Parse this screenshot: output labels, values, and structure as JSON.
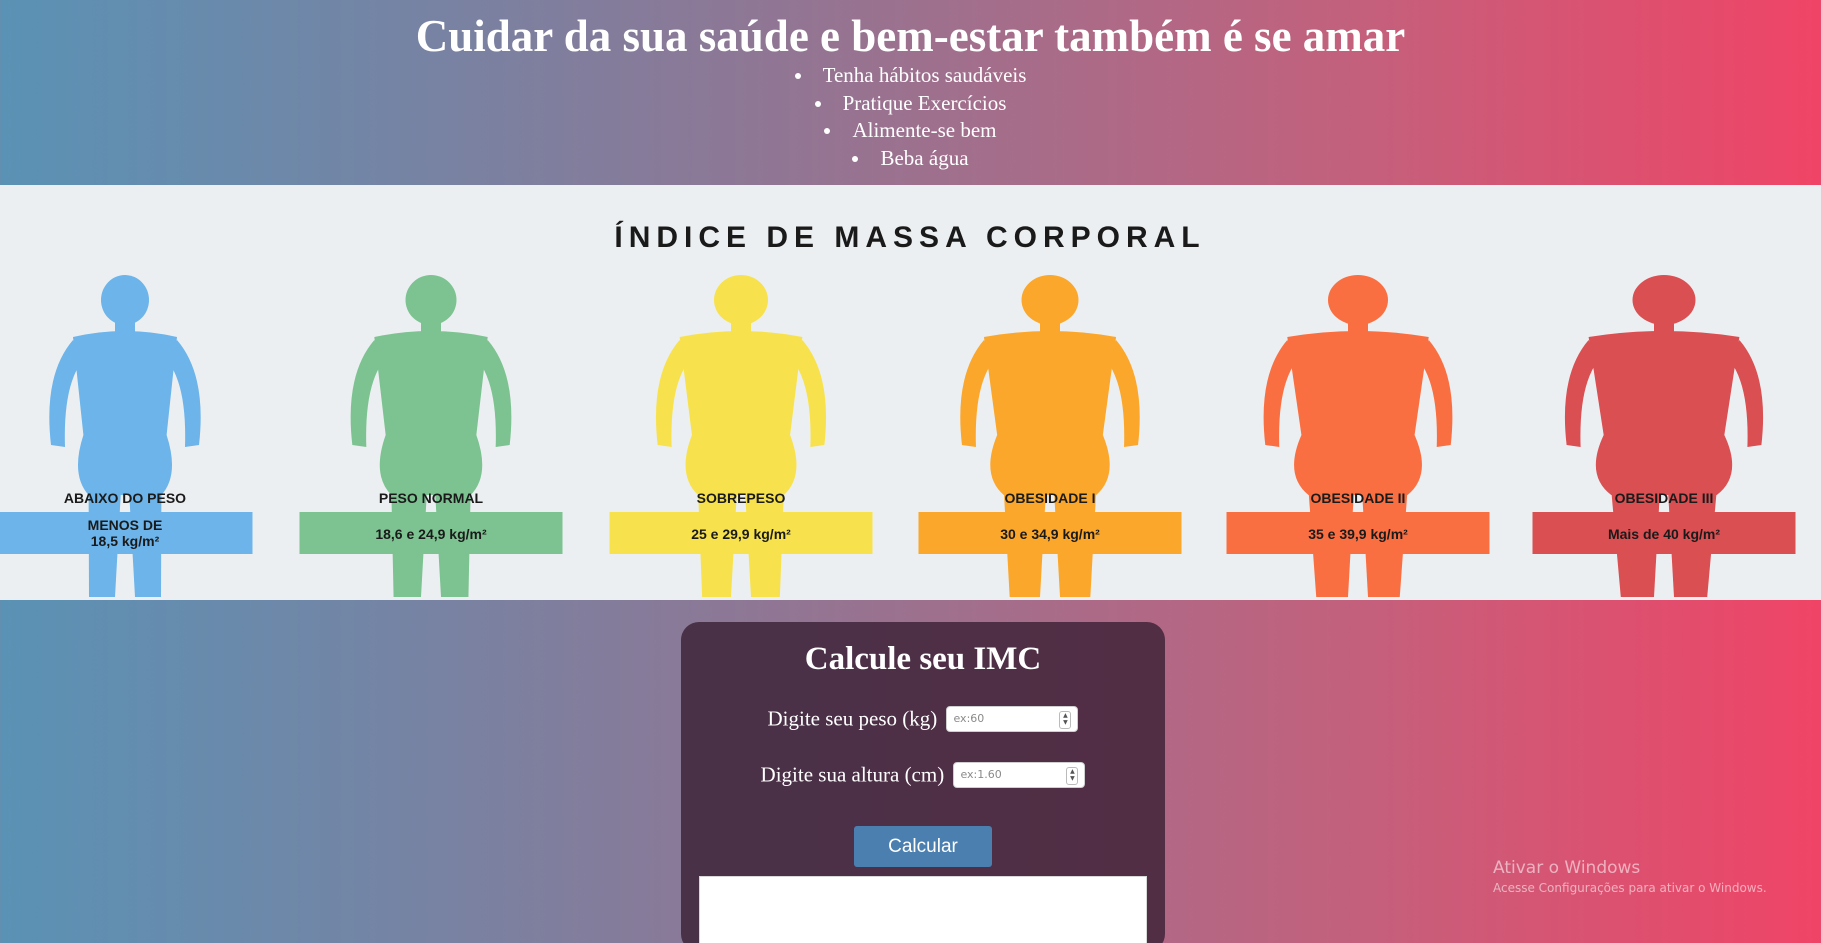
{
  "header": {
    "title": "Cuidar da sua saúde e bem-estar também é se amar",
    "tips": [
      "Tenha hábitos saudáveis",
      "Pratique Exercícios",
      "Alimente-se bem",
      "Beba água"
    ]
  },
  "bmi_chart": {
    "heading": "ÍNDICE DE MASSA CORPORAL",
    "categories": [
      {
        "name": "ABAIXO DO PESO",
        "range_line1": "MENOS DE",
        "range_line2": "18,5 kg/m²",
        "color": "#6cb4ea"
      },
      {
        "name": "PESO NORMAL",
        "range_line1": "18,6 e 24,9 kg/m²",
        "range_line2": "",
        "color": "#7dc391"
      },
      {
        "name": "SOBREPESO",
        "range_line1": "25 e 29,9 kg/m²",
        "range_line2": "",
        "color": "#f7e24e"
      },
      {
        "name": "OBESIDADE I",
        "range_line1": "30 e 34,9 kg/m²",
        "range_line2": "",
        "color": "#fba72c"
      },
      {
        "name": "OBESIDADE II",
        "range_line1": "35 e 39,9 kg/m²",
        "range_line2": "",
        "color": "#fa6f42"
      },
      {
        "name": "OBESIDADE III",
        "range_line1": "Mais de 40 kg/m²",
        "range_line2": "",
        "color": "#d94f52"
      }
    ]
  },
  "calculator": {
    "title": "Calcule seu IMC",
    "weight_label": "Digite seu peso (kg)",
    "weight_placeholder": "ex:60",
    "height_label": "Digite sua altura (cm)",
    "height_placeholder": "ex:1.60",
    "button_label": "Calcular",
    "result_text": ""
  },
  "watermark": {
    "title": "Ativar o Windows",
    "subtitle": "Acesse Configurações para ativar o Windows."
  }
}
